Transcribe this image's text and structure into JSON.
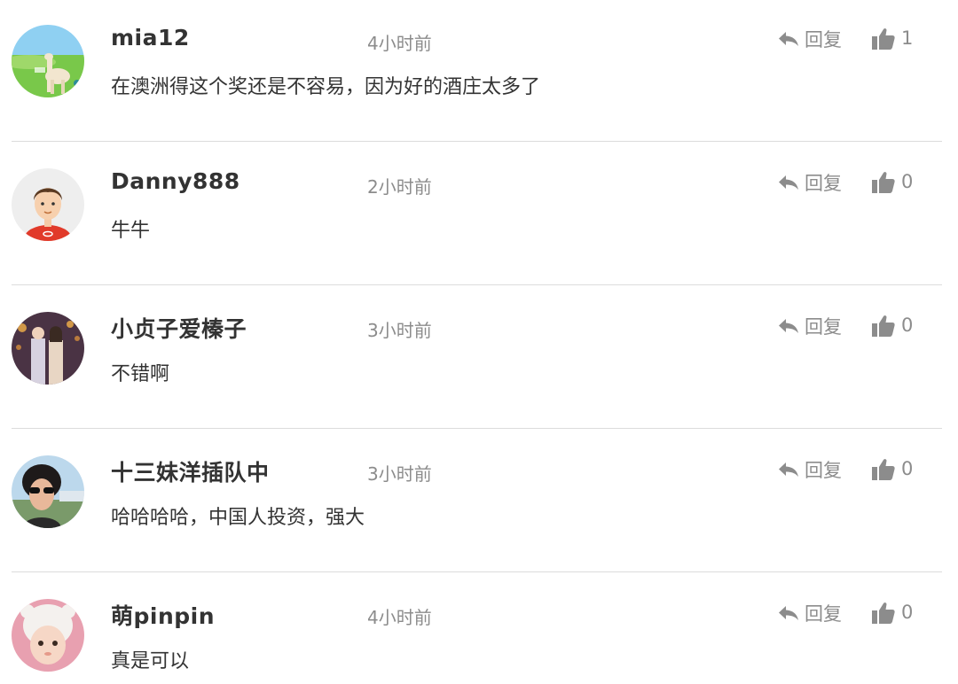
{
  "comments": [
    {
      "username": "mia12",
      "time": "4小时前",
      "reply_label": "回复",
      "likes": "1",
      "content": "在澳洲得这个奖还是不容易，因为好的酒庄太多了",
      "avatar": "llama-in-meadow"
    },
    {
      "username": "Danny888",
      "time": "2小时前",
      "reply_label": "回复",
      "likes": "0",
      "content": "牛牛",
      "avatar": "cartoon-boy"
    },
    {
      "username": "小贞子爱榛子",
      "time": "3小时前",
      "reply_label": "回复",
      "likes": "0",
      "content": "不错啊",
      "avatar": "couple-photo"
    },
    {
      "username": "十三妹洋插队中",
      "time": "3小时前",
      "reply_label": "回复",
      "likes": "0",
      "content": "哈哈哈哈，中国人投资，强大",
      "avatar": "woman-sunglasses"
    },
    {
      "username": "萌pinpin",
      "time": "4小时前",
      "reply_label": "回复",
      "likes": "0",
      "content": "真是可以",
      "avatar": "baby-white-hat"
    }
  ],
  "colors": {
    "text": "#333333",
    "muted": "#8c8c8c",
    "divider": "#dcdcdc"
  },
  "icons": {
    "reply": "reply-arrow-icon",
    "like": "thumbs-up-icon"
  }
}
